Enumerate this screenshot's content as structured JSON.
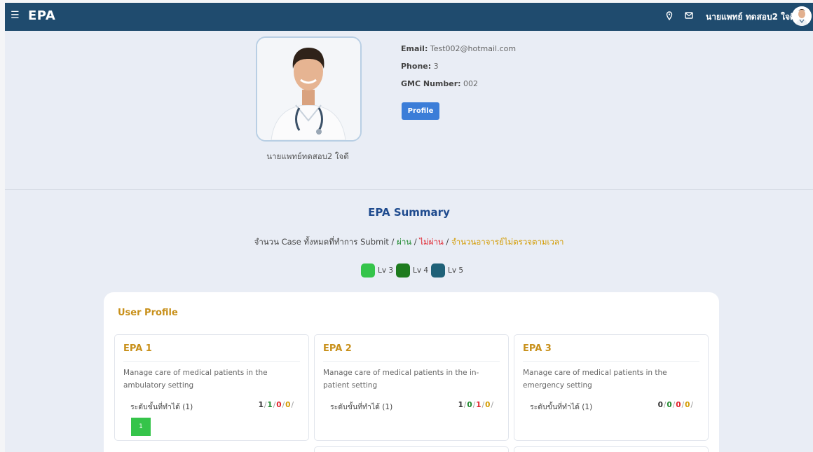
{
  "app": {
    "brand": "EPA",
    "menu_icon": "hamburger-icon"
  },
  "topbar": {
    "location_icon": "location-pin-icon",
    "mail_icon": "mail-icon",
    "user_name": "นายแพทย์ ทดสอบ2 ใจดี",
    "avatar_icon": "doctor-avatar-icon"
  },
  "profile": {
    "name": "นายแพทย์ทดสอบ2 ใจดี",
    "email_label": "Email:",
    "email": "Test002@hotmail.com",
    "phone_label": "Phone:",
    "phone": "3",
    "gmc_label": "GMC Number:",
    "gmc": "002",
    "button": "Profile"
  },
  "summary": {
    "title": "EPA Summary",
    "sub_prefix": "จำนวน Case ทั้งหมดที่ทำการ Submit / ",
    "sub_pass": "ผ่าน",
    "sub_fail": "ไม่ผ่าน",
    "sub_pending": "จำนวนอาจารย์ไม่ตรวจตามเวลา",
    "sep": " / ",
    "legend": [
      {
        "label": "Lv 3",
        "color": "#35c44a"
      },
      {
        "label": "Lv 4",
        "color": "#1e7b1e"
      },
      {
        "label": "Lv 5",
        "color": "#1f6178"
      }
    ]
  },
  "user_profile": {
    "title": "User Profile",
    "level_label": "ระดับขั้นที่ทำได้ (1)",
    "epas": [
      {
        "title": "EPA 1",
        "desc": "Manage care of medical patients in the ambulatory setting",
        "total": "1",
        "pass": "1",
        "fail": "0",
        "pending": "0",
        "box": "1"
      },
      {
        "title": "EPA 2",
        "desc": "Manage care of medical patients in the in-patient setting",
        "total": "1",
        "pass": "0",
        "fail": "1",
        "pending": "0"
      },
      {
        "title": "EPA 3",
        "desc": "Manage care of medical patients in the emergency setting",
        "total": "0",
        "pass": "0",
        "fail": "0",
        "pending": "0"
      }
    ]
  },
  "colors": {
    "topbar": "#1f4b6e",
    "accent": "#c8901a",
    "button": "#3b7dd8",
    "pass": "#1e8a2e",
    "fail": "#e0202a",
    "pending": "#d39b00"
  }
}
